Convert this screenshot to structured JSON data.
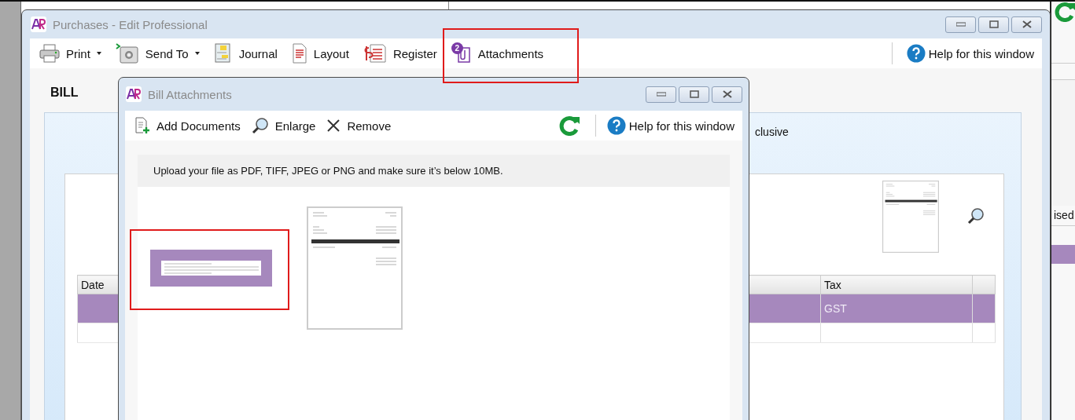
{
  "back_window": {
    "column_header": "ised"
  },
  "main_window": {
    "title": "Purchases - Edit Professional",
    "toolbar": [
      {
        "kind": "print",
        "label": "Print",
        "dropdown": true
      },
      {
        "kind": "send",
        "label": "Send To",
        "dropdown": true
      },
      {
        "kind": "journal",
        "label": "Journal",
        "dropdown": false
      },
      {
        "kind": "layout",
        "label": "Layout",
        "dropdown": false
      },
      {
        "kind": "register",
        "label": "Register",
        "dropdown": false
      },
      {
        "kind": "attachments",
        "label": "Attachments",
        "dropdown": false,
        "badge": "2"
      }
    ],
    "help": "Help for this window",
    "heading": "BILL",
    "option_text": "clusive",
    "table": {
      "columns": [
        "Date",
        "Tax"
      ],
      "rows": [
        {
          "selected": true,
          "tax": "GST"
        },
        {
          "selected": false
        }
      ]
    }
  },
  "dialog": {
    "title": "Bill Attachments",
    "toolbar": [
      {
        "kind": "add",
        "label": "Add Documents"
      },
      {
        "kind": "enlarge",
        "label": "Enlarge"
      },
      {
        "kind": "remove",
        "label": "Remove"
      }
    ],
    "help": "Help for this window",
    "hint": "Upload your file as PDF, TIFF, JPEG or PNG and make sure it’s below 10MB.",
    "attachments": [
      {
        "kind": "image"
      },
      {
        "kind": "document"
      }
    ]
  }
}
